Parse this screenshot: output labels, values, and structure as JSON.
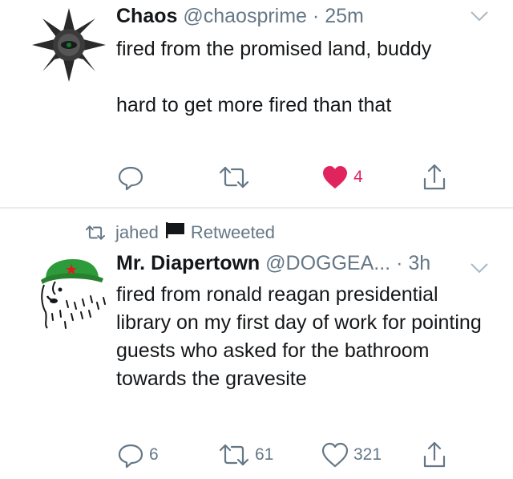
{
  "tweets": [
    {
      "display_name": "Chaos",
      "handle": "@chaosprime",
      "separator": "·",
      "time": "25m",
      "text_lines": [
        "fired from the promised land, buddy",
        "",
        "hard to get more fired than that"
      ],
      "reply_count": "",
      "retweet_count": "",
      "like_count": "4",
      "liked": true,
      "accent_color": "#e0245e"
    },
    {
      "retweet_by": "jahed",
      "retweet_label": "Retweeted",
      "display_name": "Mr. Diapertown",
      "handle": "@DOGGEA...",
      "separator": "·",
      "time": "3h",
      "text_lines": [
        "fired from ronald reagan presidential library on my first day of work for pointing guests who asked for the bathroom towards the gravesite"
      ],
      "reply_count": "6",
      "retweet_count": "61",
      "like_count": "321",
      "liked": false
    }
  ],
  "icons": {
    "reply": "reply-icon",
    "retweet": "retweet-icon",
    "like": "heart-icon",
    "share": "share-icon",
    "menu": "chevron-down-icon",
    "flag": "flag-icon"
  },
  "colors": {
    "text": "#14171a",
    "muted": "#657786",
    "like": "#e0245e",
    "divider": "#e6ecf0"
  }
}
